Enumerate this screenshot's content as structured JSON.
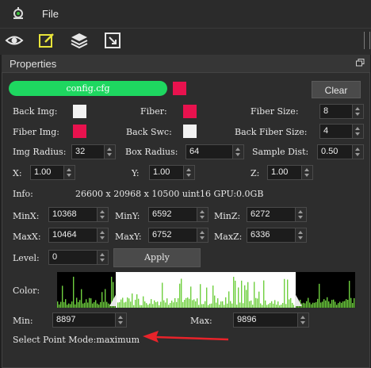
{
  "menu": {
    "file": "File"
  },
  "toolbar": {
    "icons": [
      "eye-icon",
      "edit-icon",
      "layers-icon",
      "crop-icon"
    ]
  },
  "panel": {
    "title": "Properties"
  },
  "config": {
    "file": "config.cfg",
    "clear": "Clear"
  },
  "labels": {
    "back_img": "Back Img:",
    "fiber": "Fiber:",
    "fiber_size": "Fiber Size:",
    "fiber_img": "Fiber Img:",
    "back_swc": "Back Swc:",
    "back_fiber_size": "Back Fiber Size:",
    "img_radius": "Img Radius:",
    "box_radius": "Box Radius:",
    "sample_dist": "Sample Dist:",
    "x": "X:",
    "y": "Y:",
    "z": "Z:",
    "info": "Info:",
    "minx": "MinX:",
    "miny": "MinY:",
    "minz": "MinZ:",
    "maxx": "MaxX:",
    "maxy": "MaxY:",
    "maxz": "MaxZ:",
    "level": "Level:",
    "apply": "Apply",
    "color": "Color:",
    "min": "Min:",
    "max": "Max:",
    "mode": "Select Point Mode:maximum"
  },
  "values": {
    "fiber_size": "8",
    "back_fiber_size": "4",
    "img_radius": "32",
    "box_radius": "64",
    "sample_dist": "0.50",
    "x": "1.00",
    "y": "1.00",
    "z": "1.00",
    "info": "26600 x 20968 x 10500 uint16 GPU:0.0GB",
    "minx": "10368",
    "miny": "6592",
    "minz": "6272",
    "maxx": "10464",
    "maxy": "6752",
    "maxz": "6336",
    "level": "0",
    "min": "8897",
    "max": "9896"
  },
  "colors": {
    "accent_green": "#1ed760",
    "pink": "#e8124e",
    "white": "#f2f2f2",
    "histogram_bar": "#6fcf3f",
    "annotation_arrow": "#e8232a"
  }
}
